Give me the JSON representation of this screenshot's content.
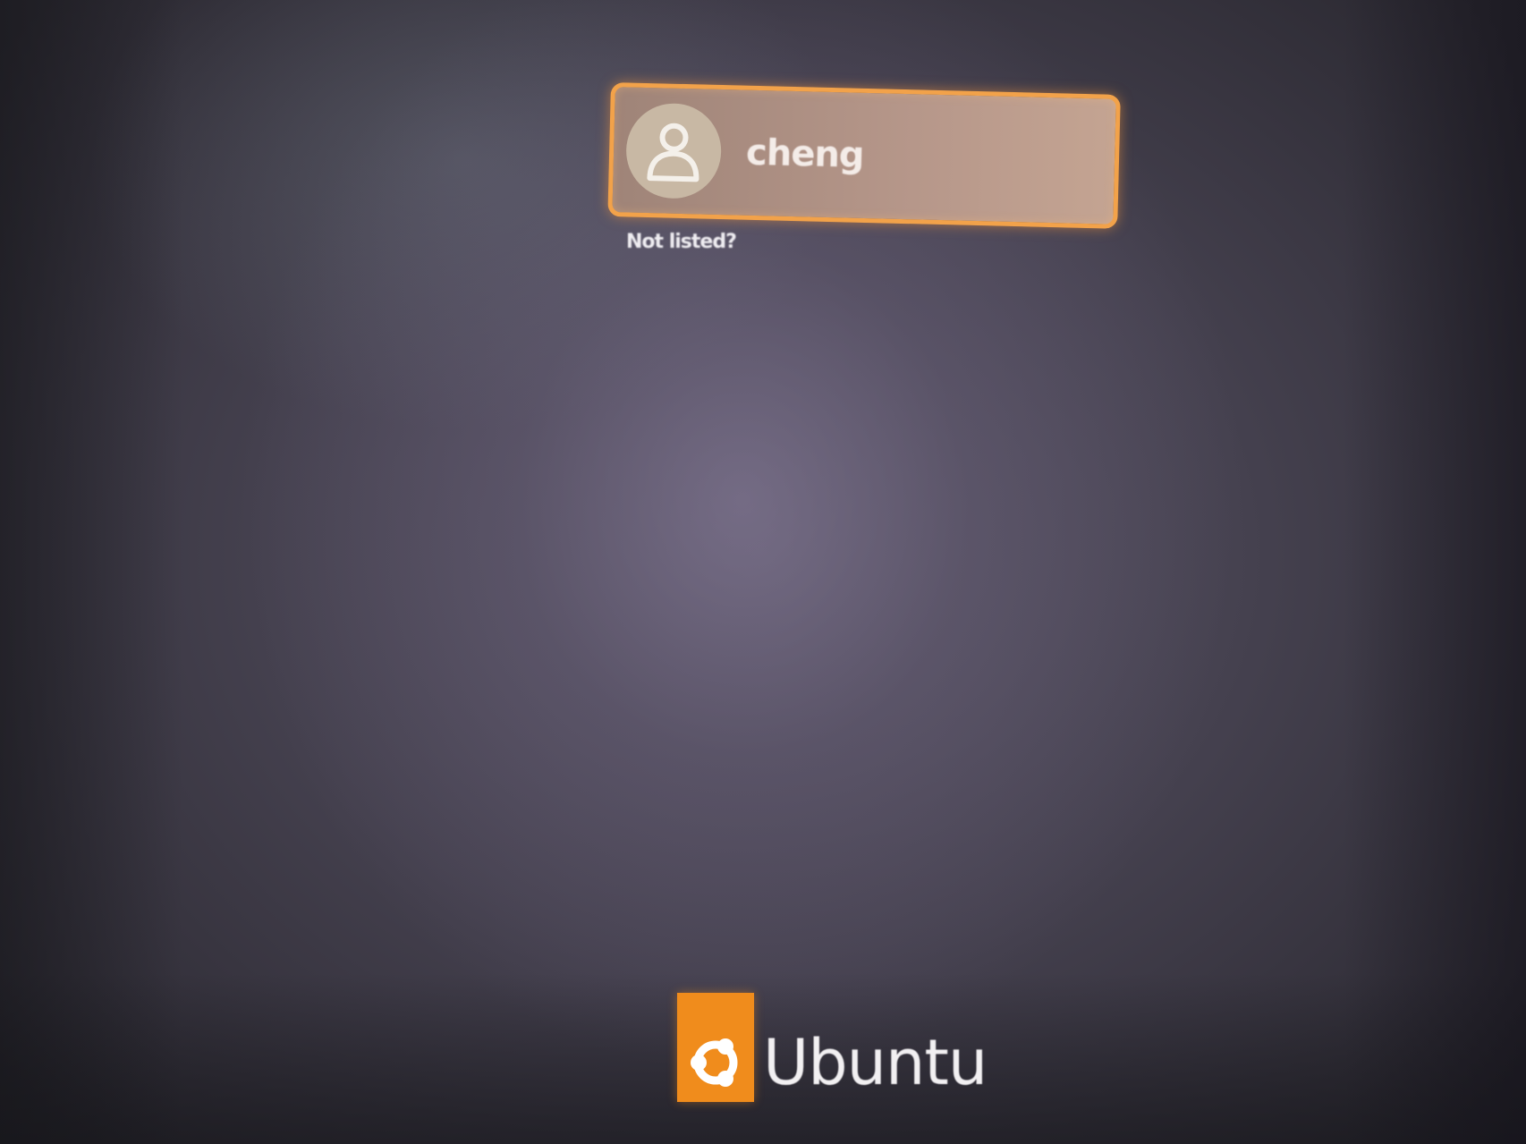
{
  "login": {
    "user_name": "cheng",
    "not_listed_label": "Not listed?"
  },
  "branding": {
    "logo_text": "Ubuntu"
  },
  "colors": {
    "accent": "#f2a24a",
    "logo_orange": "#f08c1c",
    "background": "#45414f"
  },
  "icons": {
    "avatar": "user-avatar-icon",
    "logo": "ubuntu-logo-icon"
  }
}
